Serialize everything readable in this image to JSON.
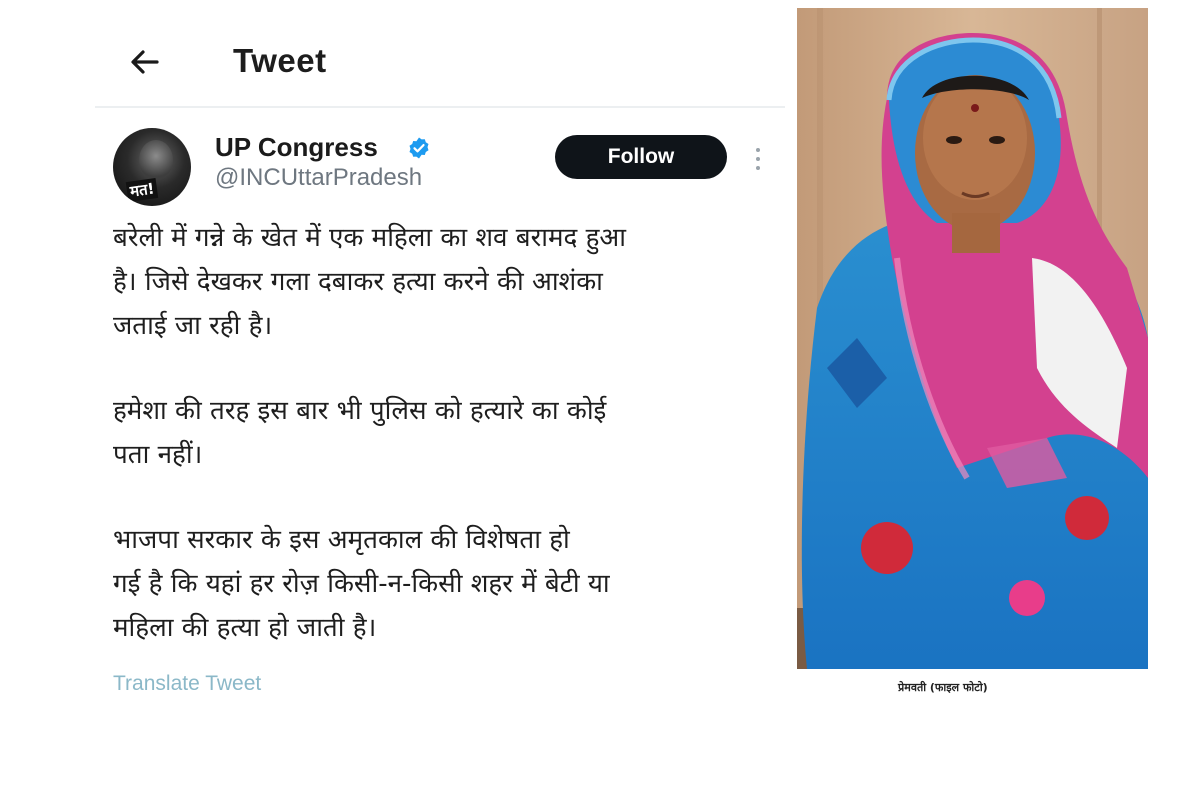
{
  "header": {
    "back_icon": "arrow-left-icon",
    "title": "Tweet"
  },
  "account": {
    "avatar_text": "मत!",
    "name": "UP Congress",
    "verified_icon": "verified-badge-icon",
    "handle": "@INCUttarPradesh",
    "follow_label": "Follow",
    "more_icon": "vertical-ellipsis-icon"
  },
  "tweet": {
    "paragraphs": [
      "बरेली में गन्ने के खेत में एक महिला का शव बरामद हुआ\nहै। जिसे देखकर गला दबाकर हत्या करने की आशंका\nजताई जा रही है।",
      "हमेशा की तरह इस बार भी पुलिस को हत्यारे का कोई\nपता नहीं।",
      "भाजपा सरकार के इस अमृतकाल की विशेषता हो\nगई है कि यहां हर रोज़ किसी-न-किसी शहर में बेटी या\nमहिला की हत्या हो जाती है।"
    ],
    "translate_label": "Translate Tweet"
  },
  "photo": {
    "caption": "प्रेमवती (फाइल फोटो)"
  },
  "colors": {
    "follow_bg": "#0f1419",
    "handle": "#6e7780",
    "translate_link": "#8bb8c8",
    "verified": "#1d9bf0"
  }
}
